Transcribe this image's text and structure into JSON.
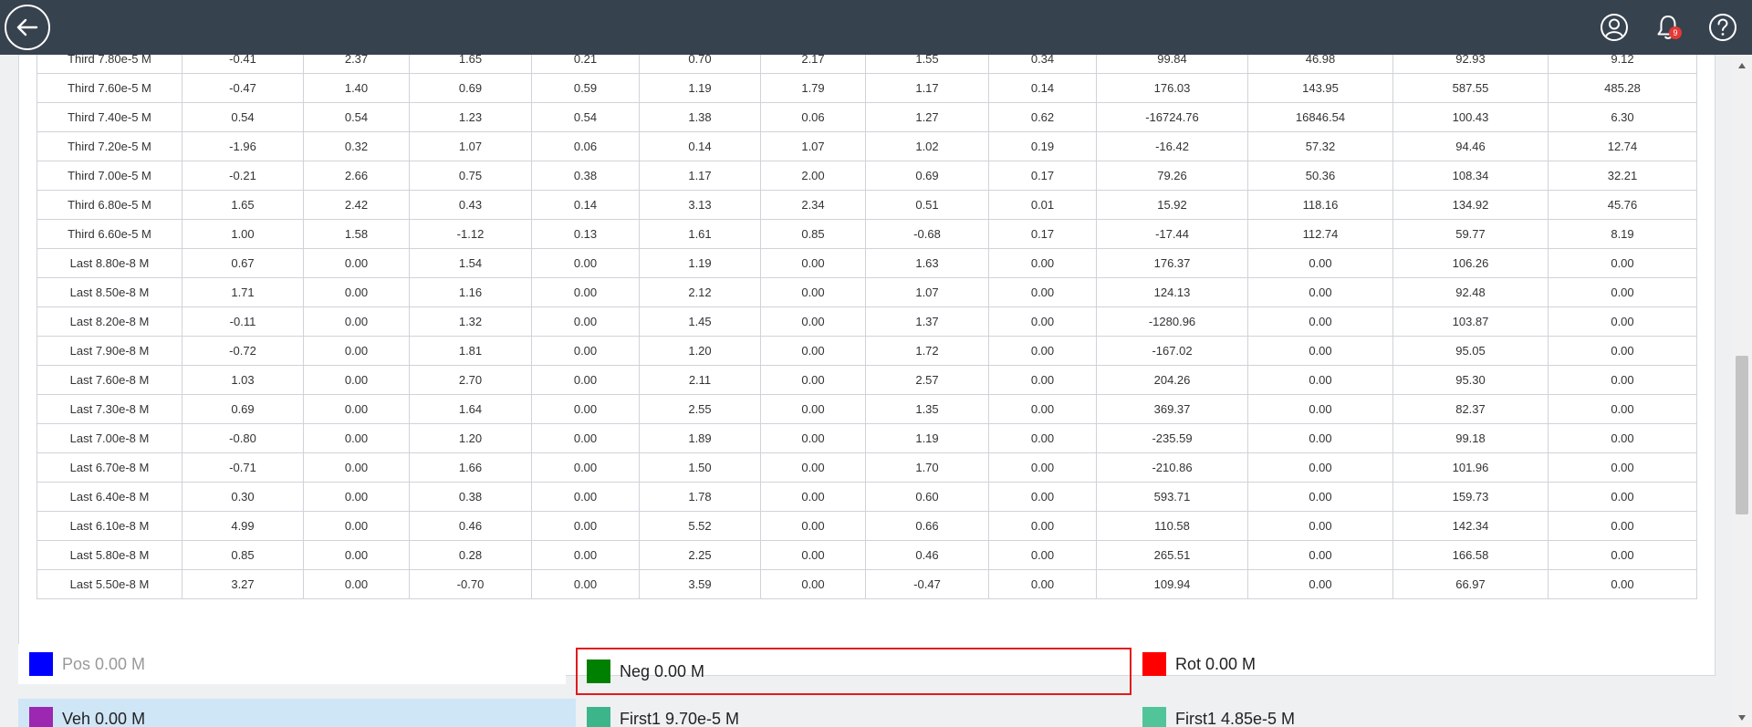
{
  "header": {
    "back_icon": "arrow-left-icon",
    "notification_count": "9",
    "icons": [
      "user-icon",
      "bell-icon",
      "help-icon"
    ]
  },
  "table": {
    "rows": [
      {
        "label": "Third 7.80e-5 M",
        "cells": [
          "-0.41",
          "2.37",
          "1.65",
          "0.21",
          "0.70",
          "2.17",
          "1.55",
          "0.34",
          "99.84",
          "46.98",
          "92.93",
          "9.12"
        ]
      },
      {
        "label": "Third 7.60e-5 M",
        "cells": [
          "-0.47",
          "1.40",
          "0.69",
          "0.59",
          "1.19",
          "1.79",
          "1.17",
          "0.14",
          "176.03",
          "143.95",
          "587.55",
          "485.28"
        ]
      },
      {
        "label": "Third 7.40e-5 M",
        "cells": [
          "0.54",
          "0.54",
          "1.23",
          "0.54",
          "1.38",
          "0.06",
          "1.27",
          "0.62",
          "-16724.76",
          "16846.54",
          "100.43",
          "6.30"
        ]
      },
      {
        "label": "Third 7.20e-5 M",
        "cells": [
          "-1.96",
          "0.32",
          "1.07",
          "0.06",
          "0.14",
          "1.07",
          "1.02",
          "0.19",
          "-16.42",
          "57.32",
          "94.46",
          "12.74"
        ]
      },
      {
        "label": "Third 7.00e-5 M",
        "cells": [
          "-0.21",
          "2.66",
          "0.75",
          "0.38",
          "1.17",
          "2.00",
          "0.69",
          "0.17",
          "79.26",
          "50.36",
          "108.34",
          "32.21"
        ]
      },
      {
        "label": "Third 6.80e-5 M",
        "cells": [
          "1.65",
          "2.42",
          "0.43",
          "0.14",
          "3.13",
          "2.34",
          "0.51",
          "0.01",
          "15.92",
          "118.16",
          "134.92",
          "45.76"
        ]
      },
      {
        "label": "Third 6.60e-5 M",
        "cells": [
          "1.00",
          "1.58",
          "-1.12",
          "0.13",
          "1.61",
          "0.85",
          "-0.68",
          "0.17",
          "-17.44",
          "112.74",
          "59.77",
          "8.19"
        ]
      },
      {
        "label": "Last 8.80e-8 M",
        "cells": [
          "0.67",
          "0.00",
          "1.54",
          "0.00",
          "1.19",
          "0.00",
          "1.63",
          "0.00",
          "176.37",
          "0.00",
          "106.26",
          "0.00"
        ]
      },
      {
        "label": "Last 8.50e-8 M",
        "cells": [
          "1.71",
          "0.00",
          "1.16",
          "0.00",
          "2.12",
          "0.00",
          "1.07",
          "0.00",
          "124.13",
          "0.00",
          "92.48",
          "0.00"
        ]
      },
      {
        "label": "Last 8.20e-8 M",
        "cells": [
          "-0.11",
          "0.00",
          "1.32",
          "0.00",
          "1.45",
          "0.00",
          "1.37",
          "0.00",
          "-1280.96",
          "0.00",
          "103.87",
          "0.00"
        ]
      },
      {
        "label": "Last 7.90e-8 M",
        "cells": [
          "-0.72",
          "0.00",
          "1.81",
          "0.00",
          "1.20",
          "0.00",
          "1.72",
          "0.00",
          "-167.02",
          "0.00",
          "95.05",
          "0.00"
        ]
      },
      {
        "label": "Last 7.60e-8 M",
        "cells": [
          "1.03",
          "0.00",
          "2.70",
          "0.00",
          "2.11",
          "0.00",
          "2.57",
          "0.00",
          "204.26",
          "0.00",
          "95.30",
          "0.00"
        ]
      },
      {
        "label": "Last 7.30e-8 M",
        "cells": [
          "0.69",
          "0.00",
          "1.64",
          "0.00",
          "2.55",
          "0.00",
          "1.35",
          "0.00",
          "369.37",
          "0.00",
          "82.37",
          "0.00"
        ]
      },
      {
        "label": "Last 7.00e-8 M",
        "cells": [
          "-0.80",
          "0.00",
          "1.20",
          "0.00",
          "1.89",
          "0.00",
          "1.19",
          "0.00",
          "-235.59",
          "0.00",
          "99.18",
          "0.00"
        ]
      },
      {
        "label": "Last 6.70e-8 M",
        "cells": [
          "-0.71",
          "0.00",
          "1.66",
          "0.00",
          "1.50",
          "0.00",
          "1.70",
          "0.00",
          "-210.86",
          "0.00",
          "101.96",
          "0.00"
        ]
      },
      {
        "label": "Last 6.40e-8 M",
        "cells": [
          "0.30",
          "0.00",
          "0.38",
          "0.00",
          "1.78",
          "0.00",
          "0.60",
          "0.00",
          "593.71",
          "0.00",
          "159.73",
          "0.00"
        ]
      },
      {
        "label": "Last 6.10e-8 M",
        "cells": [
          "4.99",
          "0.00",
          "0.46",
          "0.00",
          "5.52",
          "0.00",
          "0.66",
          "0.00",
          "110.58",
          "0.00",
          "142.34",
          "0.00"
        ]
      },
      {
        "label": "Last 5.80e-8 M",
        "cells": [
          "0.85",
          "0.00",
          "0.28",
          "0.00",
          "2.25",
          "0.00",
          "0.46",
          "0.00",
          "265.51",
          "0.00",
          "166.58",
          "0.00"
        ]
      },
      {
        "label": "Last 5.50e-8 M",
        "cells": [
          "3.27",
          "0.00",
          "-0.70",
          "0.00",
          "3.59",
          "0.00",
          "-0.47",
          "0.00",
          "109.94",
          "0.00",
          "66.97",
          "0.00"
        ]
      }
    ]
  },
  "legend": [
    {
      "label": "Pos 0.00 M",
      "color": "#0000ff",
      "state": "disabled"
    },
    {
      "label": "Neg 0.00 M",
      "color": "#008000",
      "state": "focused"
    },
    {
      "label": "Rot 0.00 M",
      "color": "#ff0000",
      "state": "normal"
    },
    {
      "label": "Veh 0.00 M",
      "color": "#9c27b0",
      "state": "hover"
    },
    {
      "label": "First1 9.70e-5 M",
      "color": "#3db58b",
      "state": "normal"
    },
    {
      "label": "First1 4.85e-5 M",
      "color": "#52c49a",
      "state": "normal"
    }
  ]
}
